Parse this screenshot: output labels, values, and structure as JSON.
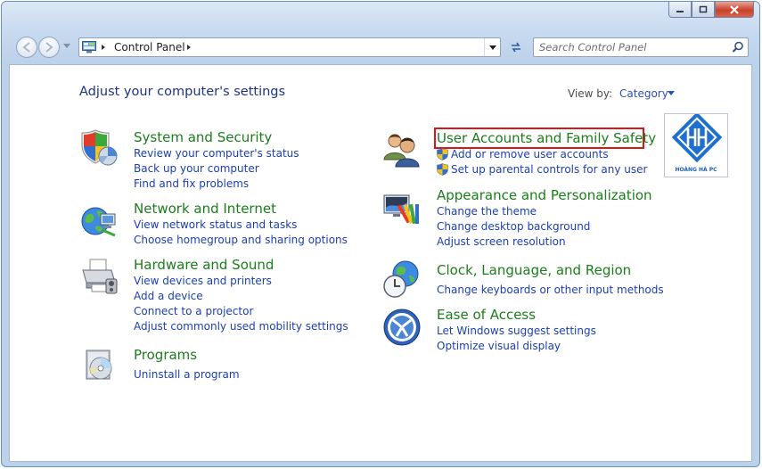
{
  "address": {
    "path": "Control Panel"
  },
  "search": {
    "placeholder": "Search Control Panel"
  },
  "header": {
    "title": "Adjust your computer's settings",
    "view_by_label": "View by:",
    "view_by_value": "Category"
  },
  "left_categories": [
    {
      "title": "System and Security",
      "icon": "system-security-icon",
      "links": [
        "Review your computer's status",
        "Back up your computer",
        "Find and fix problems"
      ]
    },
    {
      "title": "Network and Internet",
      "icon": "network-globe-icon",
      "links": [
        "View network status and tasks",
        "Choose homegroup and sharing options"
      ]
    },
    {
      "title": "Hardware and Sound",
      "icon": "printer-icon",
      "links": [
        "View devices and printers",
        "Add a device",
        "Connect to a projector",
        "Adjust commonly used mobility settings"
      ]
    },
    {
      "title": "Programs",
      "icon": "programs-disc-icon",
      "links": [
        "Uninstall a program"
      ]
    }
  ],
  "right_categories": [
    {
      "title": "User Accounts and Family Safety",
      "icon": "users-icon",
      "links": [
        "Add or remove user accounts",
        "Set up parental controls for any user"
      ]
    },
    {
      "title": "Appearance and Personalization",
      "icon": "appearance-icon",
      "links": [
        "Change the theme",
        "Change desktop background",
        "Adjust screen resolution"
      ]
    },
    {
      "title": "Clock, Language, and Region",
      "icon": "clock-globe-icon",
      "links": [
        "Change keyboards or other input methods"
      ]
    },
    {
      "title": "Ease of Access",
      "icon": "ease-of-access-icon",
      "links": [
        "Let Windows suggest settings",
        "Optimize visual display"
      ]
    }
  ],
  "logo": {
    "text": "HOÀNG HÀ PC"
  },
  "colors": {
    "title_green": "#1b7d1b",
    "link_blue": "#1c3fb0",
    "heading_blue": "#1e3287",
    "highlight_red": "#d81818"
  }
}
